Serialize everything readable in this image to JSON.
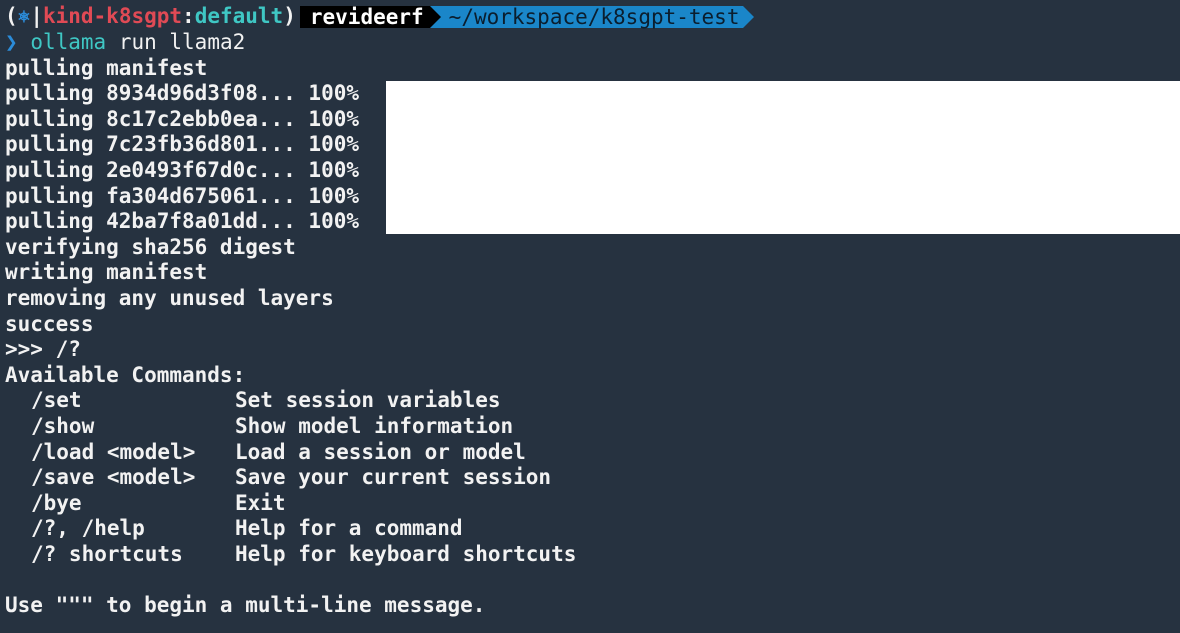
{
  "prompt": {
    "paren_open": "(",
    "kube_icon": "⎈",
    "separator": "|",
    "cluster": "kind-k8sgpt",
    "colon": ":",
    "namespace": "default",
    "paren_close": ")",
    "user": "revideerf",
    "path": "~/workspace/k8sgpt-test"
  },
  "command": {
    "chevron": "❯",
    "program": "ollama",
    "args": " run llama2"
  },
  "output_lines": [
    "pulling manifest",
    "pulling 8934d96d3f08... 100%",
    "pulling 8c17c2ebb0ea... 100%",
    "pulling 7c23fb36d801... 100%",
    "pulling 2e0493f67d0c... 100%",
    "pulling fa304d675061... 100%",
    "pulling 42ba7f8a01dd... 100%",
    "verifying sha256 digest",
    "writing manifest",
    "removing any unused layers",
    "success",
    ">>> /?",
    "Available Commands:"
  ],
  "commands": [
    {
      "name": "/set",
      "desc": "Set session variables"
    },
    {
      "name": "/show",
      "desc": "Show model information"
    },
    {
      "name": "/load <model>",
      "desc": "Load a session or model"
    },
    {
      "name": "/save <model>",
      "desc": "Save your current session"
    },
    {
      "name": "/bye",
      "desc": "Exit"
    },
    {
      "name": "/?, /help",
      "desc": "Help for a command"
    },
    {
      "name": "/? shortcuts",
      "desc": "Help for keyboard shortcuts"
    }
  ],
  "footer": "Use \"\"\" to begin a multi-line message.",
  "colors": {
    "background": "#263240",
    "cluster": "#e04a55",
    "namespace": "#3fc7c4",
    "path_segment": "#1a86c9",
    "user_segment": "#000000"
  }
}
